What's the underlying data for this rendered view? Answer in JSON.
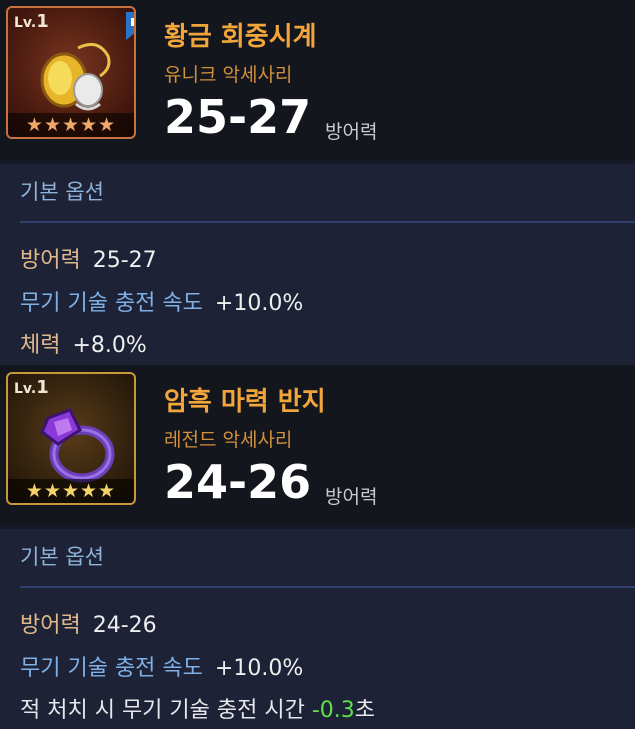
{
  "items": [
    {
      "level_prefix": "Lv.",
      "level": "1",
      "stars": "★★★★★",
      "name": "황금 회중시계",
      "category": "유니크 악세사리",
      "stat_value": "25-27",
      "stat_unit": "방어력",
      "options_title": "기본 옵션",
      "options": [
        {
          "key": "방어력",
          "value": "25-27"
        },
        {
          "key": "무기 기술 충전 속도",
          "value": "+10.0%"
        },
        {
          "key": "체력",
          "value": "+8.0%"
        }
      ],
      "colors": {
        "frame": "#c8733f",
        "name": "#f1a53a"
      }
    },
    {
      "level_prefix": "Lv.",
      "level": "1",
      "stars": "★★★★★",
      "name": "암흑 마력 반지",
      "category": "레전드 악세사리",
      "stat_value": "24-26",
      "stat_unit": "방어력",
      "options_title": "기본 옵션",
      "options": [
        {
          "key": "방어력",
          "value": "24-26"
        },
        {
          "key": "무기 기술 충전 속도",
          "value": "+10.0%"
        },
        {
          "key_pre": "적 처치 시 무기 기술 충전 시간 ",
          "value_green": "-0.3",
          "suffix": "초"
        }
      ],
      "colors": {
        "frame": "#c69a3a",
        "name": "#f1a53a"
      }
    }
  ]
}
